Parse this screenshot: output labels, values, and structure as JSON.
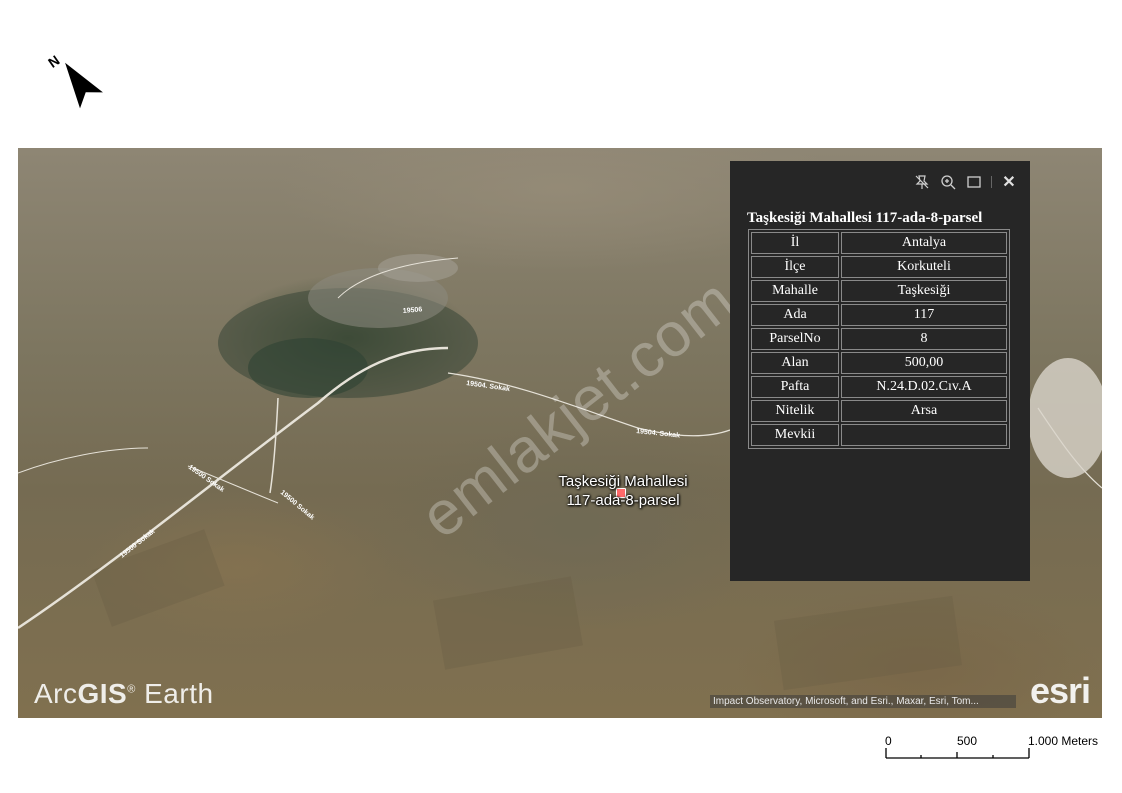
{
  "north_arrow": {
    "letter": "N"
  },
  "map": {
    "road_labels": [
      "19506",
      "19504. Sokak",
      "19504. Sokak",
      "19500 Sokak",
      "19500 Sokak",
      "19500 Sokak"
    ],
    "parcel_label": {
      "line1": "Taşkesiği Mahallesi",
      "line2": "117-ada-8-parsel"
    },
    "watermark": "emlakjet.com",
    "arcgis_logo": {
      "part1": "Arc",
      "part2": "GIS",
      "reg": "®",
      "part3": "Earth"
    },
    "attribution": "Impact Observatory, Microsoft, and Esri., Maxar, Esri, Tom...",
    "esri_logo": "esri"
  },
  "popup": {
    "icons": [
      "pin-icon",
      "zoom-in-icon",
      "maximize-icon",
      "close-icon"
    ],
    "close_glyph": "✕",
    "title": "Taşkesiği Mahallesi 117-ada-8-parsel",
    "rows": [
      {
        "key": "İl",
        "value": "Antalya"
      },
      {
        "key": "İlçe",
        "value": "Korkuteli"
      },
      {
        "key": "Mahalle",
        "value": "Taşkesiği"
      },
      {
        "key": "Ada",
        "value": "117"
      },
      {
        "key": "ParselNo",
        "value": "8"
      },
      {
        "key": "Alan",
        "value": "500,00"
      },
      {
        "key": "Pafta",
        "value": "N.24.D.02.Cıv.A"
      },
      {
        "key": "Nitelik",
        "value": "Arsa"
      },
      {
        "key": "Mevkii",
        "value": ""
      }
    ]
  },
  "scale_bar": {
    "label_0": "0",
    "label_500": "500",
    "label_1000": "1.000 Meters"
  },
  "colors": {
    "popup_bg": "#262626",
    "marker": "#ff6a6a"
  }
}
